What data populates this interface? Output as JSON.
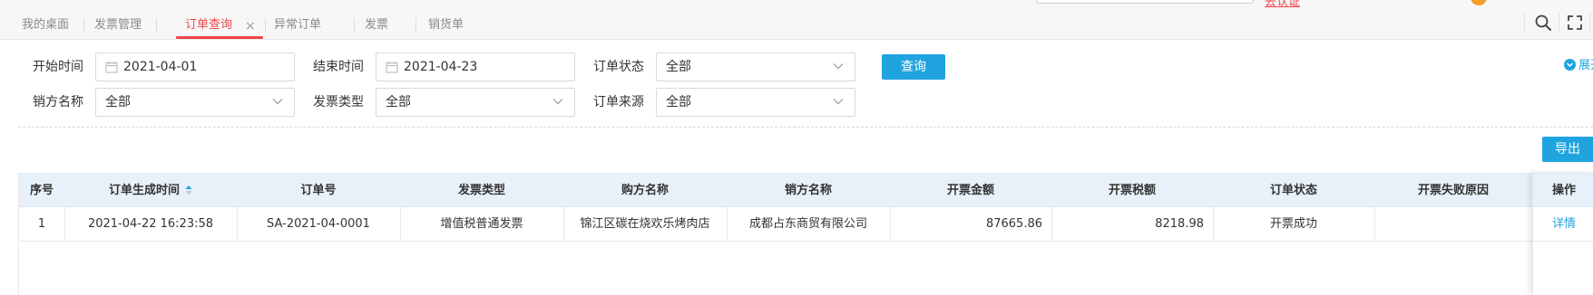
{
  "tabs": [
    {
      "label": "我的桌面"
    },
    {
      "label": "发票管理"
    },
    {
      "label": "订单查询",
      "active": true,
      "closable": true
    },
    {
      "label": "异常订单"
    },
    {
      "label": "发票"
    },
    {
      "label": "销货单"
    }
  ],
  "tab_close_glyph": "×",
  "header_link": "去认证",
  "toolbar_icons": [
    "search-icon",
    "fullscreen-icon"
  ],
  "filters": {
    "start_time": {
      "label": "开始时间",
      "value": "2021-04-01"
    },
    "end_time": {
      "label": "结束时间",
      "value": "2021-04-23"
    },
    "order_status": {
      "label": "订单状态",
      "value": "全部"
    },
    "seller_name": {
      "label": "销方名称",
      "value": "全部"
    },
    "invoice_type": {
      "label": "发票类型",
      "value": "全部"
    },
    "order_source": {
      "label": "订单来源",
      "value": "全部"
    },
    "query_label": "查询",
    "expand_label": "展开"
  },
  "export_label": "导出",
  "table": {
    "columns": [
      "序号",
      "订单生成时间",
      "订单号",
      "发票类型",
      "购方名称",
      "销方名称",
      "开票金额",
      "开票税额",
      "订单状态",
      "开票失败原因",
      "操作"
    ],
    "rows": [
      {
        "index": "1",
        "created_at": "2021-04-22 16:23:58",
        "order_no": "SA-2021-04-0001",
        "invoice_type": "增值税普通发票",
        "buyer": "锦江区碳在烧欢乐烤肉店",
        "seller": "成都占东商贸有限公司",
        "amount": "87665.86",
        "tax": "8218.98",
        "status": "开票成功",
        "fail_reason": "",
        "action": "详情"
      }
    ]
  },
  "colors": {
    "accent": "#20a4e0",
    "active_tab": "#f0454b",
    "header_bg": "#e8f1fa"
  }
}
